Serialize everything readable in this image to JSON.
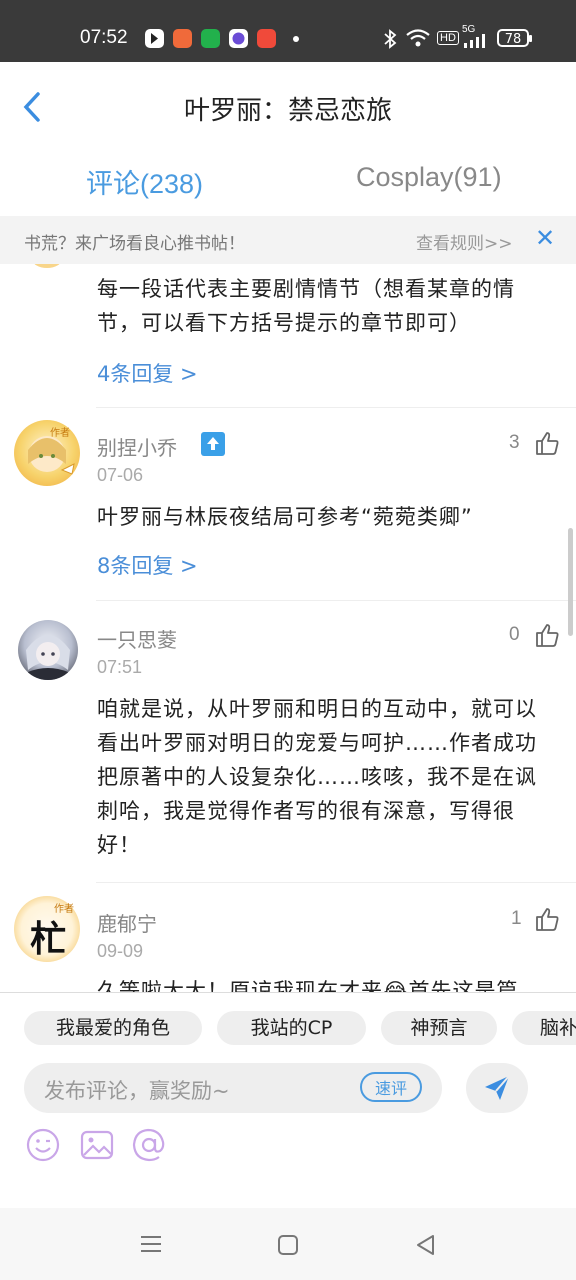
{
  "status_bar": {
    "time": "07:52",
    "battery": "78",
    "network": "5G",
    "hd": "HD",
    "app_icon_colors": [
      "#ffffff",
      "#f06a3a",
      "#22b14c",
      "#6b4cd6",
      "#f04a3a"
    ]
  },
  "header": {
    "title": "叶罗丽：禁忌恋旅",
    "back_icon": "chevron-left-icon"
  },
  "tabs": [
    {
      "label": "评论(238)",
      "active": true
    },
    {
      "label": "Cosplay(91)",
      "active": false
    }
  ],
  "banner": {
    "text": "书荒？来广场看良心推书帖！",
    "rules_link": "查看规则>>",
    "close_icon": "close-icon"
  },
  "comments": [
    {
      "partial": true,
      "text": "每一段话代表主要剧情情节（想看某章的情节，可以看下方括号提示的章节即可）",
      "replies": "4条回复 >"
    },
    {
      "username": "别捏小乔",
      "date": "07-06",
      "likes": "3",
      "author_badge": "作者",
      "text": "叶罗丽与林辰夜结局可参考“菀菀类卿”",
      "replies": "8条回复 >"
    },
    {
      "username": "一只思菱",
      "date": "07:51",
      "likes": "0",
      "text": "咱就是说，从叶罗丽和明日的互动中，就可以看出叶罗丽对明日的宠爱与呵护……作者成功把原著中的人设复杂化……咳咳，我不是在讽刺哈，我是觉得作者写的很有深意，写得很好！"
    },
    {
      "username": "鹿郁宁",
      "date": "09-09",
      "likes": "1",
      "author_badge": "作者",
      "avatar_text": "杧",
      "text": "久等啦大大！原谅我现在才来😂首先这是篇"
    }
  ],
  "composer": {
    "chips": [
      "我最爱的角色",
      "我站的CP",
      "神预言",
      "脑补"
    ],
    "placeholder": "发布评论，赢奖励~",
    "quick_review": "速评",
    "send_icon": "send-icon",
    "tools": [
      "emoji-icon",
      "image-icon",
      "at-icon"
    ]
  },
  "colors": {
    "accent": "#4a9be0",
    "reply_link": "#4a8ed8",
    "tool_icon": "#c9a6e8"
  }
}
